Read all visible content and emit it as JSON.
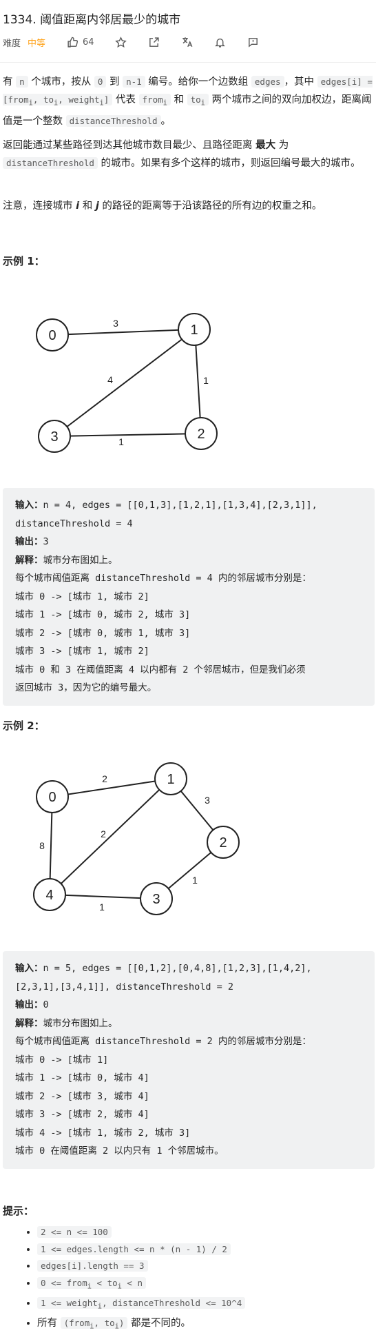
{
  "header": {
    "title": "1334. 阈值距离内邻居最少的城市",
    "difficulty_label": "难度",
    "difficulty": "中等",
    "likes": "64"
  },
  "description": {
    "p1": [
      "有 ",
      "n",
      " 个城市，按从 ",
      "0",
      " 到 ",
      "n-1",
      " 编号。给你一个边数组 ",
      "edges",
      "，其中 ",
      "edges[i] = [from",
      "i",
      ", to",
      "i",
      ", weight",
      "i",
      "]",
      " 代表 ",
      "from",
      "i",
      " 和 ",
      "to",
      "i",
      " 两个城市之间的双向加权边，距离阈值是一个整数 ",
      "distanceThreshold",
      "。"
    ],
    "p2": [
      "返回能通过某些路径到达其他城市数目最少、且路径距离 ",
      "最大",
      " 为 ",
      "distanceThreshold",
      " 的城市。如果有多个这样的城市，则返回编号最大的城市。"
    ],
    "p3": [
      "注意，连接城市 ",
      "i",
      " 和 ",
      "j",
      " 的路径的距离等于沿该路径的所有边的权重之和。"
    ]
  },
  "example1": {
    "heading": "示例 1：",
    "graph": {
      "nodes": [
        "0",
        "1",
        "2",
        "3"
      ],
      "edges": [
        {
          "from": "0",
          "to": "1",
          "weight": "3"
        },
        {
          "from": "1",
          "to": "2",
          "weight": "1"
        },
        {
          "from": "1",
          "to": "3",
          "weight": "4"
        },
        {
          "from": "2",
          "to": "3",
          "weight": "1"
        }
      ]
    },
    "input_label": "输入：",
    "input": "n = 4, edges = [[0,1,3],[1,2,1],[1,3,4],[2,3,1]],",
    "input2": "distanceThreshold = 4",
    "output_label": "输出：",
    "output": "3",
    "explain_label": "解释：",
    "explain": "城市分布图如上。",
    "lines": [
      "每个城市阈值距离 distanceThreshold = 4 内的邻居城市分别是：",
      "城市 0 -> [城市 1, 城市 2]",
      "城市 1 -> [城市 0, 城市 2, 城市 3]",
      "城市 2 -> [城市 0, 城市 1, 城市 3]",
      "城市 3 -> [城市 1, 城市 2]",
      "城市 0 和 3 在阈值距离 4 以内都有 2 个邻居城市，但是我们必须",
      "返回城市 3，因为它的编号最大。"
    ]
  },
  "example2": {
    "heading": "示例 2：",
    "graph": {
      "nodes": [
        "0",
        "1",
        "2",
        "3",
        "4"
      ],
      "edges": [
        {
          "from": "0",
          "to": "1",
          "weight": "2"
        },
        {
          "from": "0",
          "to": "4",
          "weight": "8"
        },
        {
          "from": "1",
          "to": "2",
          "weight": "3"
        },
        {
          "from": "1",
          "to": "4",
          "weight": "2"
        },
        {
          "from": "2",
          "to": "3",
          "weight": "1"
        },
        {
          "from": "3",
          "to": "4",
          "weight": "1"
        }
      ]
    },
    "input_label": "输入：",
    "input": "n = 5, edges = [[0,1,2],[0,4,8],[1,2,3],[1,4,2],",
    "input2": "[2,3,1],[3,4,1]], distanceThreshold = 2",
    "output_label": "输出：",
    "output": "0",
    "explain_label": "解释：",
    "explain": "城市分布图如上。",
    "lines": [
      "每个城市阈值距离 distanceThreshold = 2 内的邻居城市分别是：",
      "城市 0 -> [城市 1]",
      "城市 1 -> [城市 0, 城市 4]",
      "城市 2 -> [城市 3, 城市 4]",
      "城市 3 -> [城市 2, 城市 4]",
      "城市 4 -> [城市 1, 城市 2, 城市 3]",
      "城市 0 在阈值距离 2 以内只有 1 个邻居城市。"
    ]
  },
  "tips": {
    "heading": "提示：",
    "items": [
      [
        "2 <= n <= 100"
      ],
      [
        "1 <= edges.length <= n * (n - 1) / 2"
      ],
      [
        "edges[i].length == 3"
      ],
      [
        "0 <= from",
        "i",
        " < to",
        "i",
        " < n"
      ],
      [
        "1 <= weight",
        "i",
        ",  distanceThreshold <= 10^4"
      ],
      [
        "所有 ",
        "(from",
        "i",
        ", to",
        "i",
        ")",
        " 都是不同的。"
      ]
    ]
  }
}
